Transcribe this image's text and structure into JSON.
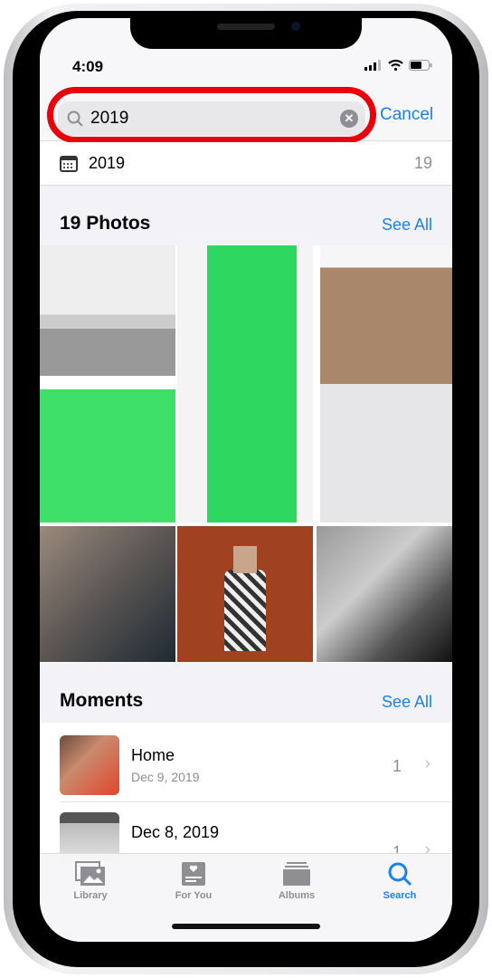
{
  "status": {
    "time": "4:09"
  },
  "search": {
    "query": "2019",
    "cancel": "Cancel"
  },
  "suggestion": {
    "label": "2019",
    "count": "19"
  },
  "photos": {
    "title": "19 Photos",
    "see_all": "See All"
  },
  "moments": {
    "title": "Moments",
    "see_all": "See All",
    "items": [
      {
        "title": "Home",
        "subtitle": "Dec 9, 2019",
        "count": "1"
      },
      {
        "title": "Dec 8, 2019",
        "subtitle": "",
        "count": "1"
      }
    ]
  },
  "tabs": [
    {
      "label": "Library",
      "icon": "photo-stack-icon"
    },
    {
      "label": "For You",
      "icon": "heart-card-icon"
    },
    {
      "label": "Albums",
      "icon": "albums-icon"
    },
    {
      "label": "Search",
      "icon": "search-icon",
      "active": true
    }
  ],
  "colors": {
    "accent": "#1a82e8",
    "highlight": "#e8000b"
  }
}
